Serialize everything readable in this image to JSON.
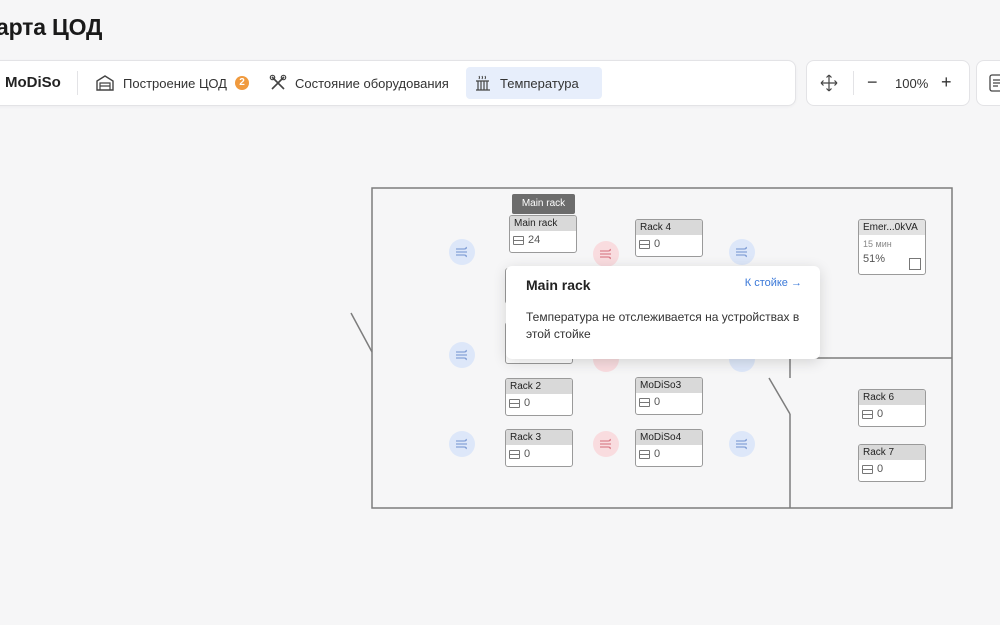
{
  "page": {
    "title": "арта ЦОД"
  },
  "toolbar": {
    "brand": "MoDiSo",
    "tabs": [
      {
        "label": "Построение ЦОД",
        "badge": "2",
        "icon": "warehouse-icon"
      },
      {
        "label": "Состояние оборудования",
        "icon": "tools-icon"
      },
      {
        "label": "Температура",
        "icon": "thermo-icon",
        "active": true
      }
    ]
  },
  "zoom": {
    "fit_icon": "move-icon",
    "minus": "−",
    "value": "100%",
    "plus": "+"
  },
  "racks": [
    {
      "name": "Main rack",
      "value": "24"
    },
    {
      "name": "Rack 4",
      "value": "0"
    },
    {
      "name": "Rack 2",
      "value": "0"
    },
    {
      "name": "MoDiSo3",
      "value": "0"
    },
    {
      "name": "Rack 3",
      "value": "0"
    },
    {
      "name": "MoDiSo4",
      "value": "0"
    },
    {
      "name": "Rack 6",
      "value": "0"
    },
    {
      "name": "Rack 7",
      "value": "0"
    }
  ],
  "ups": {
    "name": "Emer...0kVA",
    "time": "15 мин",
    "percent": "51%"
  },
  "rack_tooltip": "Main rack",
  "popover": {
    "title": "Main rack",
    "link": "К стойке",
    "text": "Температура не отслеживается на устройствах в этой стойке"
  },
  "colors": {
    "accent": "#3a78d8",
    "badge": "#f09a3e",
    "hot": "#f9dcdf",
    "cold": "#dde7f9"
  }
}
